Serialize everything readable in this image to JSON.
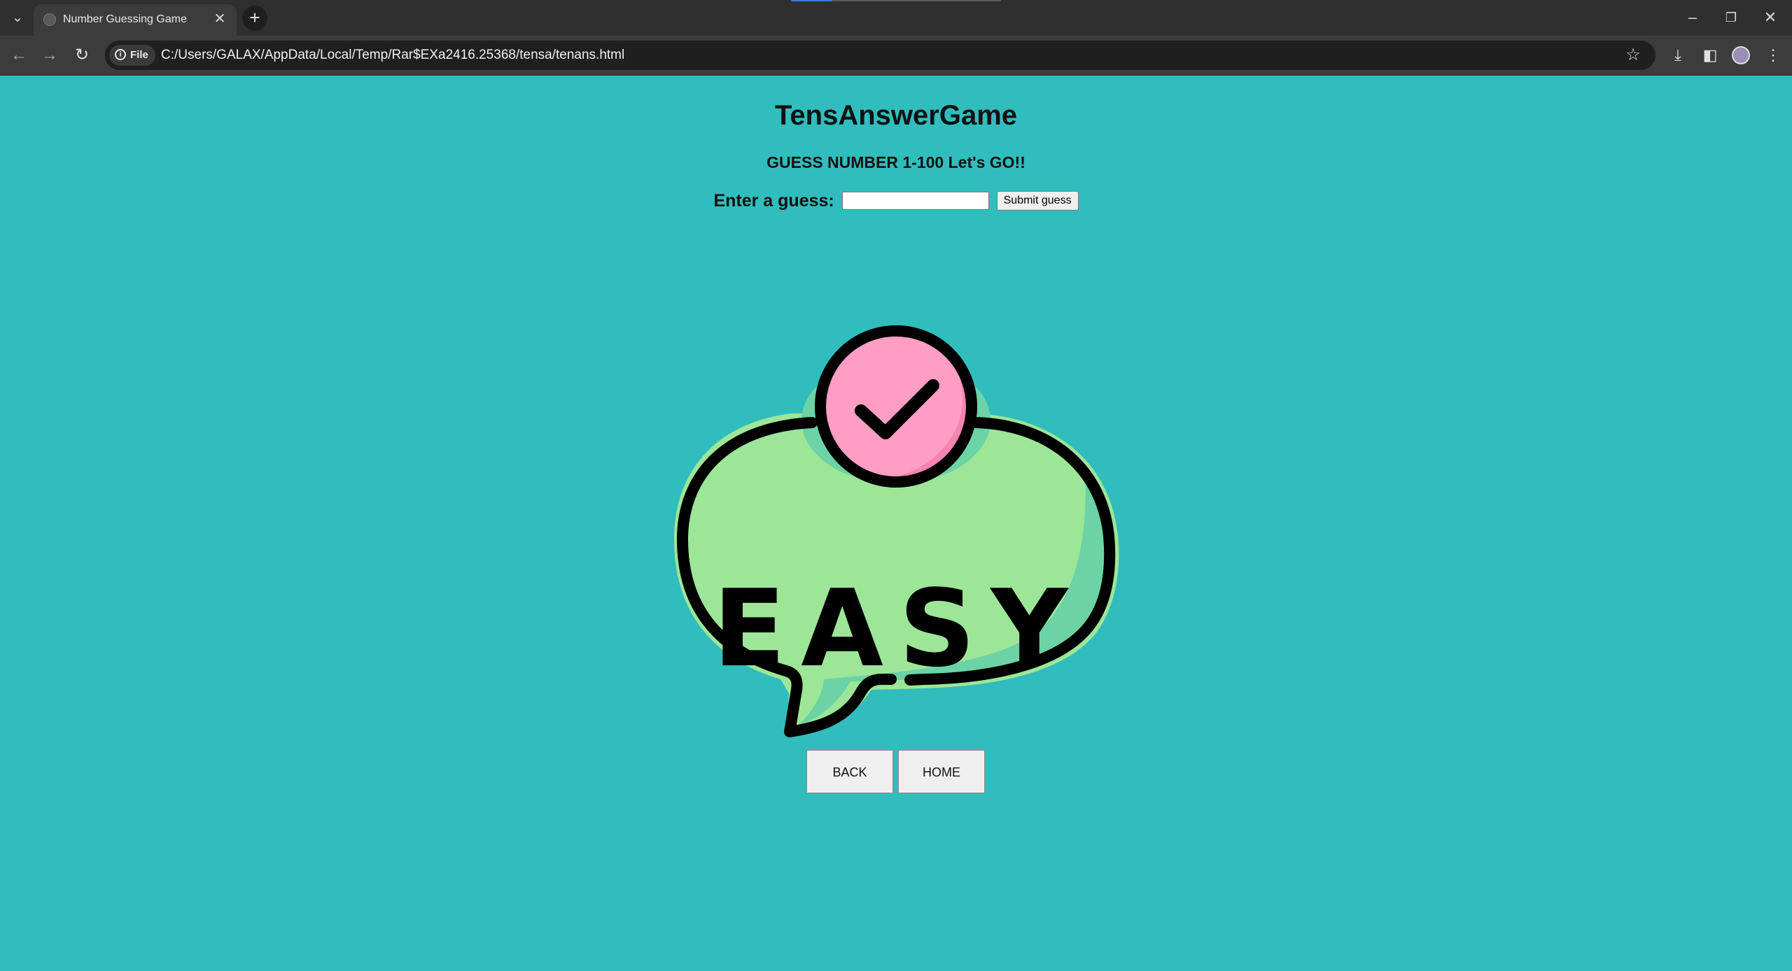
{
  "browser": {
    "tab_title": "Number Guessing Game",
    "address_chip": "File",
    "url": "C:/Users/GALAX/AppData/Local/Temp/Rar$EXa2416.25368/tensa/tenans.html"
  },
  "page": {
    "title": "TensAnswerGame",
    "subtitle": "GUESS NUMBER 1-100 Let's GO!!",
    "guess_label": "Enter a guess:",
    "guess_value": "",
    "submit_label": "Submit guess",
    "badge_text": "EASY",
    "back_label": "BACK",
    "home_label": "HOME"
  },
  "colors": {
    "page_background": "#31bdbd",
    "bubble_fill": "#9de698",
    "bubble_shadow": "#6bd3a6",
    "check_circle": "#ff9ec2",
    "check_shadow": "#f484b0"
  }
}
